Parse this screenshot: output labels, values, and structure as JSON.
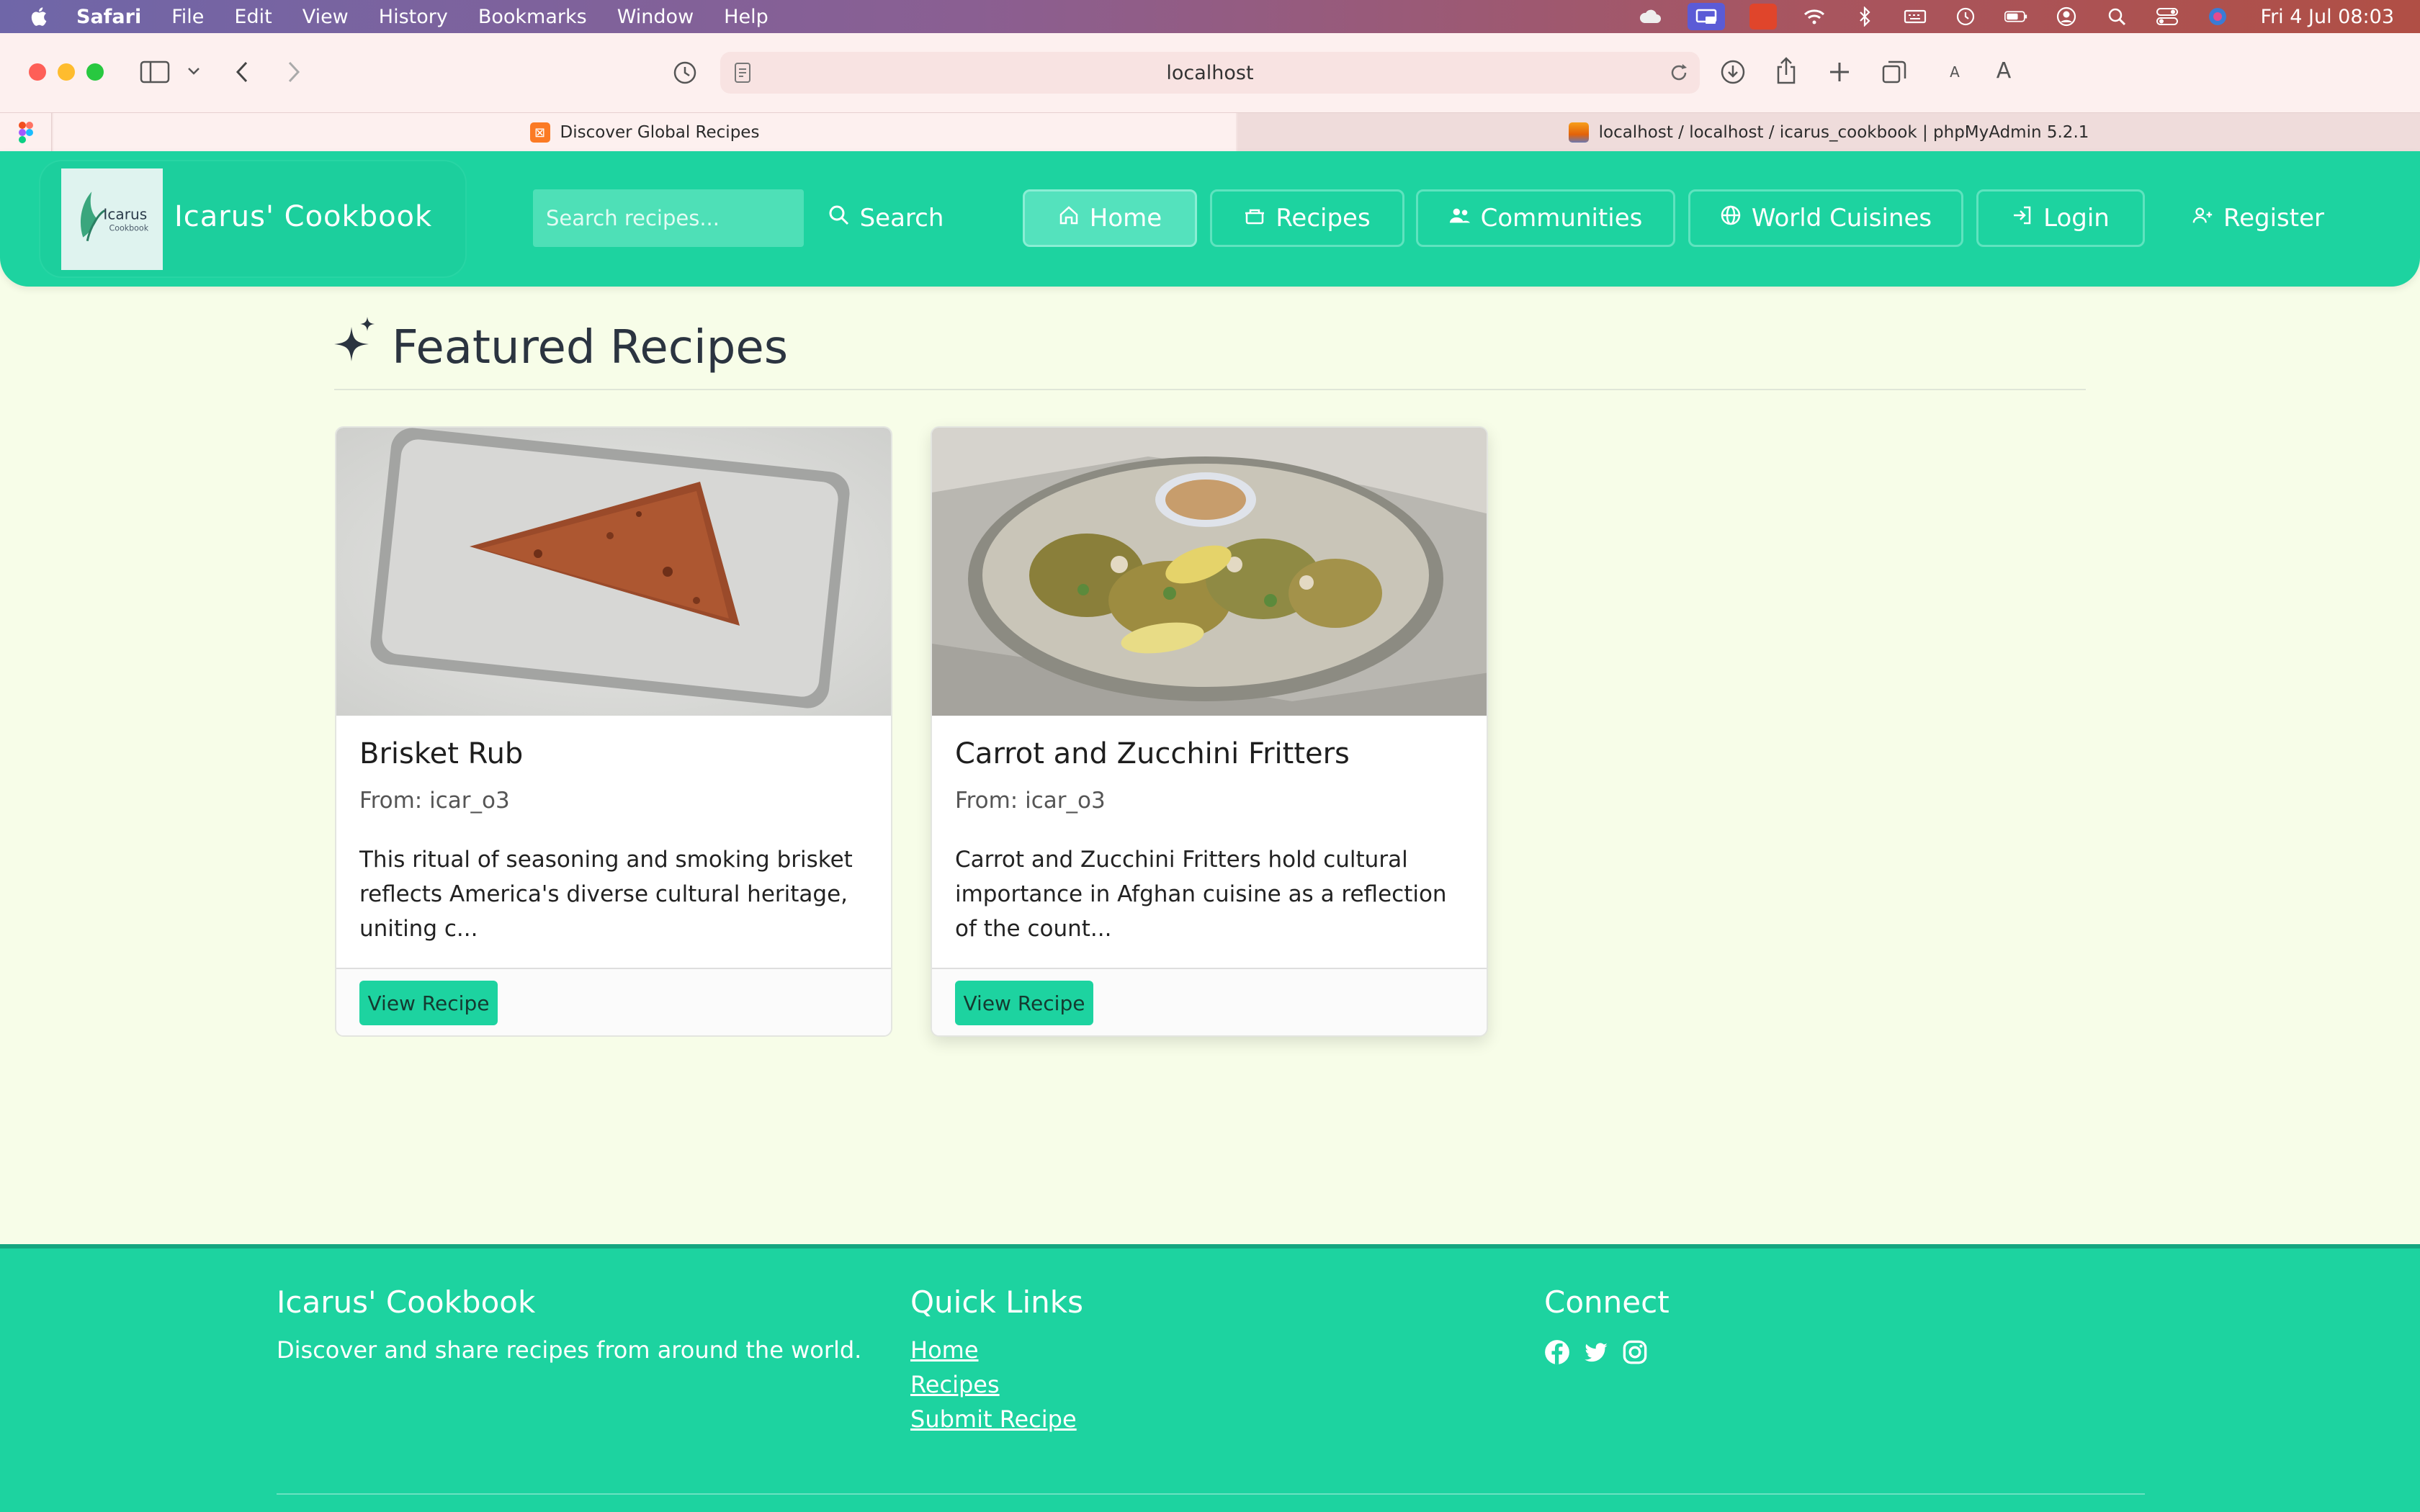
{
  "menubar": {
    "app": "Safari",
    "items": [
      "File",
      "Edit",
      "View",
      "History",
      "Bookmarks",
      "Window",
      "Help"
    ],
    "clock": "Fri 4 Jul  08:03"
  },
  "browser": {
    "url": "localhost",
    "tabs": [
      {
        "title": "Discover Global Recipes",
        "active": true
      },
      {
        "title": "localhost / localhost / icarus_cookbook | phpMyAdmin 5.2.1",
        "active": false
      }
    ]
  },
  "header": {
    "logo_text": "Icarus",
    "logo_subtext": "Cookbook",
    "brand": "Icarus' Cookbook",
    "search_placeholder": "Search recipes...",
    "search_label": "Search",
    "nav": {
      "home": "Home",
      "recipes": "Recipes",
      "communities": "Communities",
      "world": "World Cuisines",
      "login": "Login",
      "register": "Register"
    }
  },
  "main": {
    "title": "Featured Recipes",
    "cards": [
      {
        "title": "Brisket Rub",
        "author": "From: icar_o3",
        "description": "This ritual of seasoning and smoking brisket reflects America's diverse cultural heritage, uniting c...",
        "button": "View Recipe"
      },
      {
        "title": "Carrot and Zucchini Fritters",
        "author": "From: icar_o3",
        "description": "Carrot and Zucchini Fritters hold cultural importance in Afghan cuisine as a reflection of the count...",
        "button": "View Recipe"
      }
    ]
  },
  "footer": {
    "brand": "Icarus' Cookbook",
    "tagline": "Discover and share recipes from around the world.",
    "quick_links_title": "Quick Links",
    "links": [
      "Home",
      "Recipes",
      "Submit Recipe"
    ],
    "connect_title": "Connect",
    "social": [
      "facebook-icon",
      "twitter-icon",
      "instagram-icon"
    ]
  },
  "colors": {
    "accent": "#1dd3a0",
    "page_bg": "#f7fde8"
  }
}
